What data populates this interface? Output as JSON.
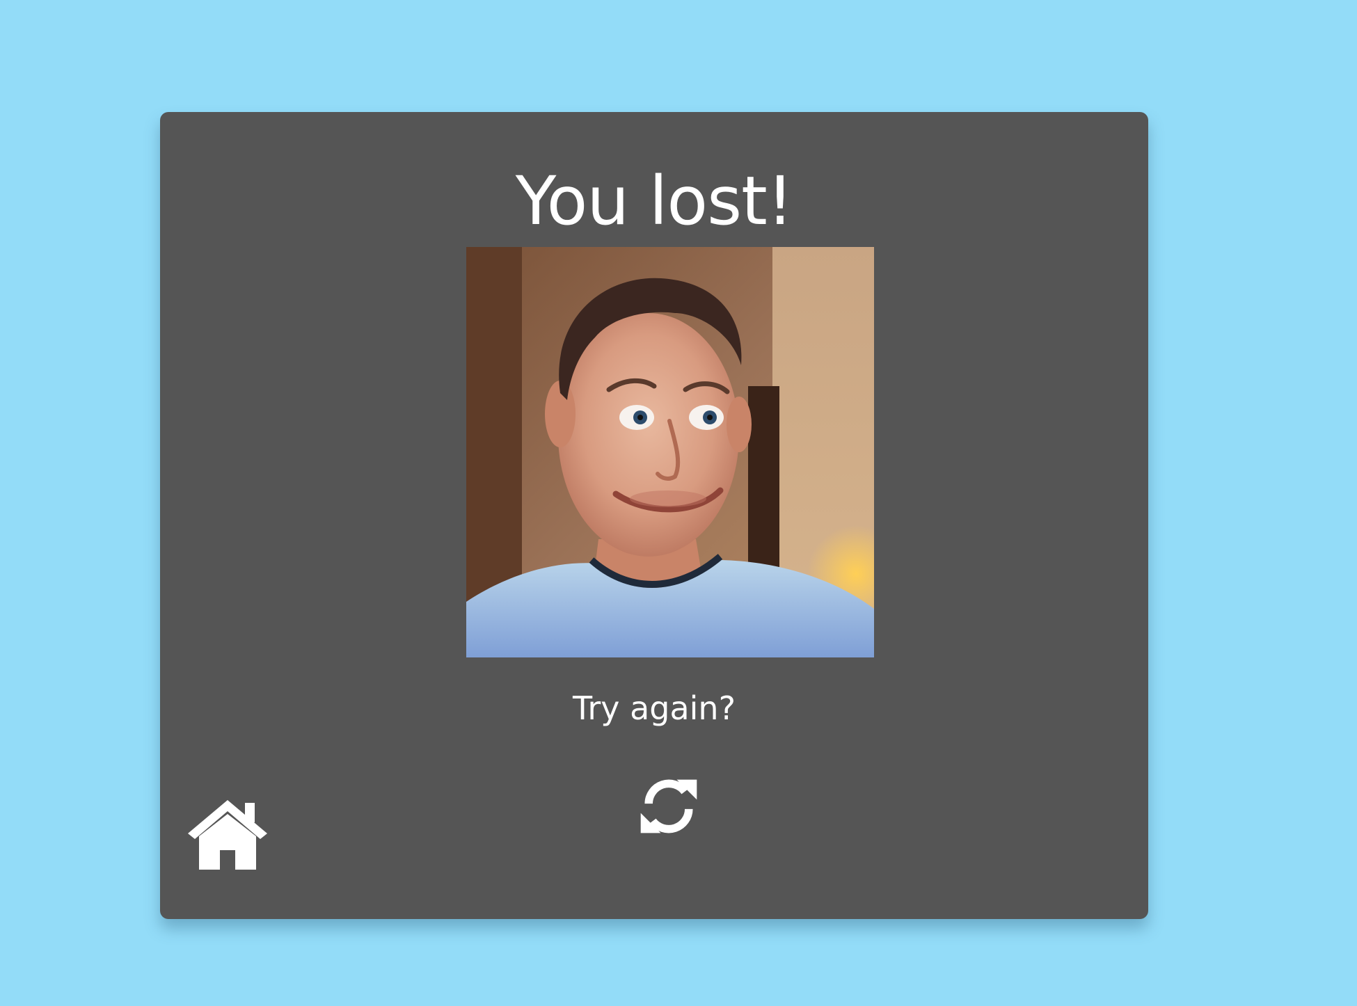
{
  "result": {
    "title": "You lost!",
    "prompt": "Try again?"
  },
  "reaction_image": {
    "description_icon": "surprised-face-reaction-image"
  },
  "controls": {
    "restart_icon": "refresh-icon",
    "home_icon": "home-icon"
  },
  "colors": {
    "background": "#93dcf8",
    "card": "#555555",
    "text": "#ffffff"
  }
}
